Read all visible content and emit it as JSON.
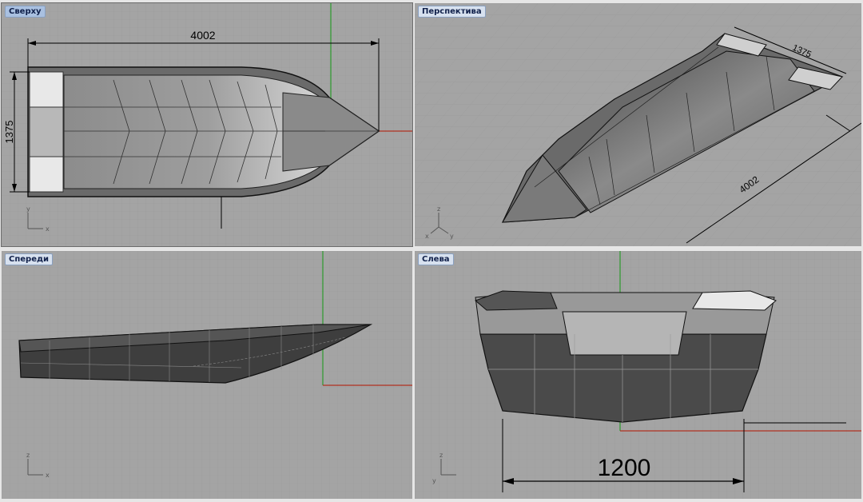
{
  "viewports": {
    "top": {
      "title": "Сверху",
      "dim_length": "4002",
      "dim_width": "1375",
      "axis_h": "x",
      "axis_v": "y"
    },
    "perspective": {
      "title": "Перспектива",
      "dim_length": "4002",
      "dim_width": "1375",
      "axis_z": "z",
      "axis_x": "x",
      "axis_y": "y"
    },
    "front": {
      "title": "Спереди",
      "axis_h": "x",
      "axis_v": "z"
    },
    "left": {
      "title": "Слева",
      "dim_width": "1200",
      "axis_h": "y",
      "axis_v": "z"
    }
  },
  "colors": {
    "background": "#a4a4a4",
    "grid": "#9a9a9a",
    "hull": "#5a5a5a",
    "x_axis": "#b03020",
    "y_axis": "#2c9a2c"
  }
}
